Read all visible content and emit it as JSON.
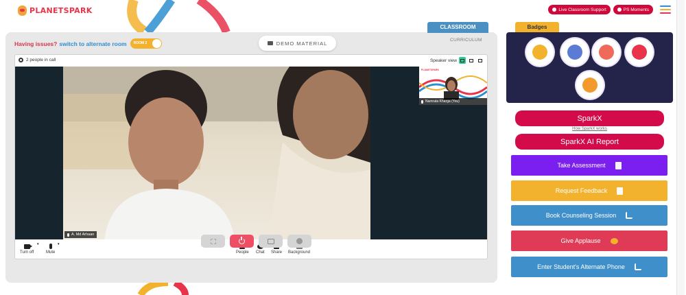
{
  "app": {
    "logo_text": "PLANETSPARK"
  },
  "header": {
    "live_support": "Live Classroom Support",
    "ps_moments": "PS Moments",
    "menu_colors": [
      "#2d8fd0",
      "#f2b22e",
      "#e8334a"
    ]
  },
  "classroom": {
    "issues_text": "Having issues?",
    "switch_text": "switch to alternate room",
    "room_toggle": "ROOM 2",
    "demo_material": "DEMO MATERIAL",
    "classroom_tab": "CLASSROOM",
    "curriculum": "CURRICULUM"
  },
  "video": {
    "people_count": "2 people in call",
    "speaker_view": "Speaker view",
    "main_participant": "A. Md Arhaan",
    "self_participant": "Namrata Kharga (You)",
    "self_brand": "PLANETSPARK"
  },
  "controls": {
    "turn_off": "Turn off",
    "mute": "Mute",
    "people": "People",
    "chat": "Chat",
    "share": "Share",
    "background": "Background"
  },
  "sidebar": {
    "badges_title": "Badges",
    "sparkx": "SparkX",
    "how_sparkx": "How SparkX works",
    "sparkx_ai": "SparkX AI Report",
    "actions": [
      {
        "label": "Take Assessment",
        "color": "#7a1ff0"
      },
      {
        "label": "Request Feedback",
        "color": "#f2b22e"
      },
      {
        "label": "Book Counseling Session",
        "color": "#3f8fca"
      },
      {
        "label": "Give Applause",
        "color": "#df3b57"
      },
      {
        "label": "Enter Student's Alternate Phone",
        "color": "#3f8fca"
      }
    ]
  },
  "colors": {
    "accent_red": "#d30b4b",
    "panel_bg": "#e8e8e8",
    "badges_bg": "#24244a"
  }
}
